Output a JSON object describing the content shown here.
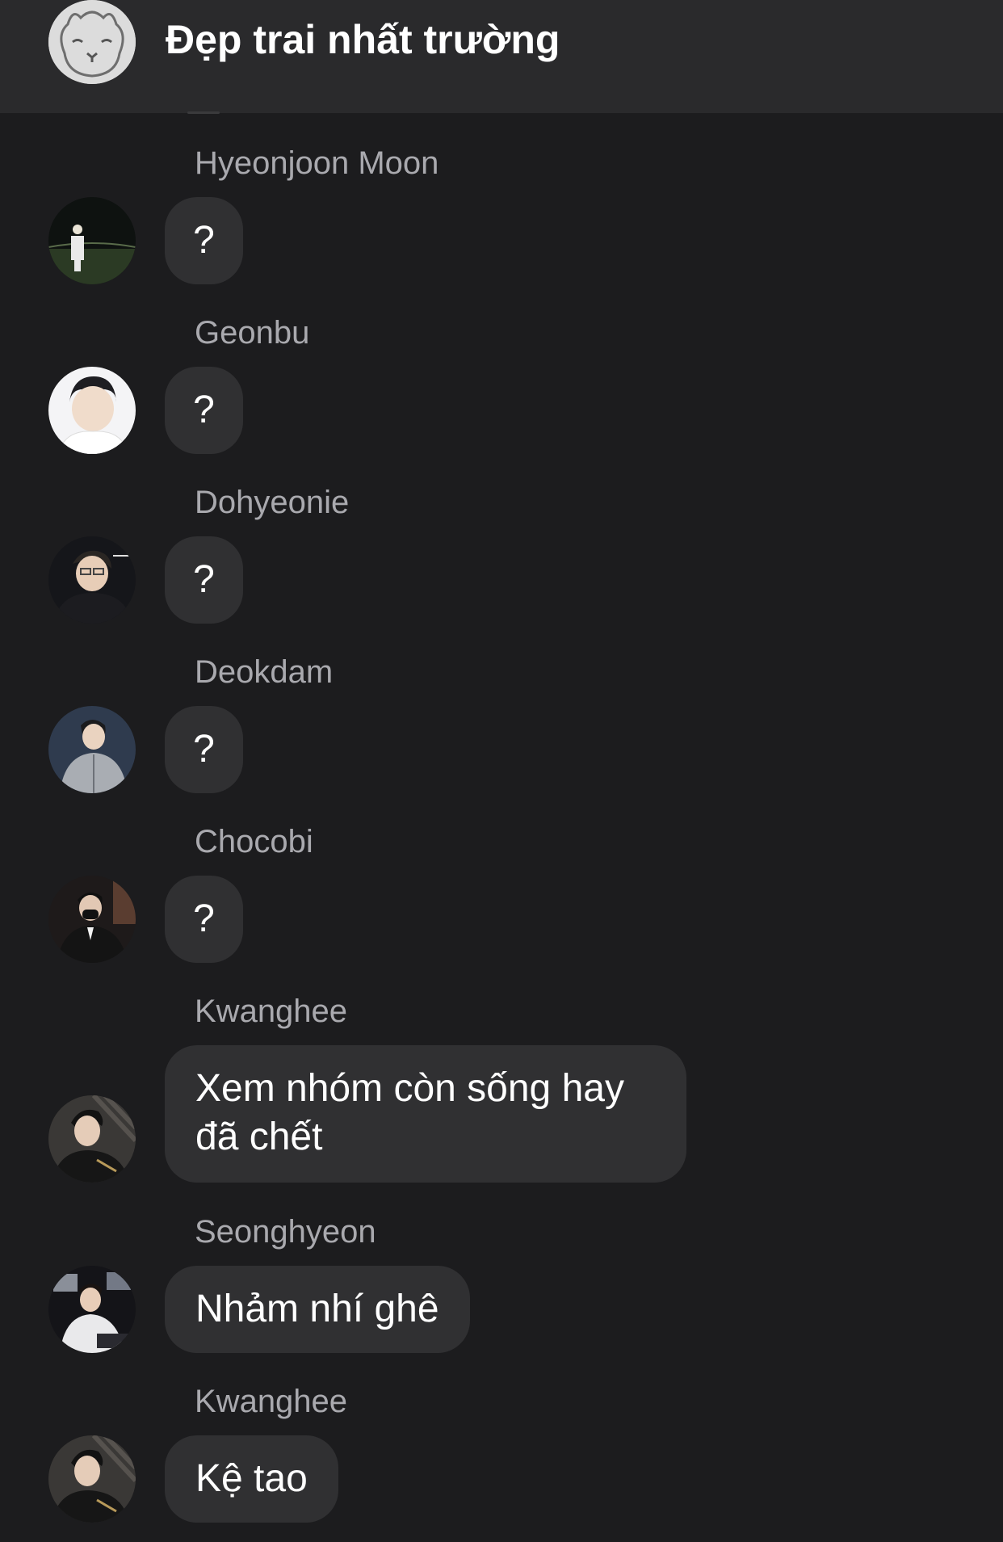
{
  "header": {
    "title": "Đẹp trai nhất trường",
    "avatar_icon": "alpaca-icon"
  },
  "messages": [
    {
      "sender": "Hyeonjoon Moon",
      "text": "?"
    },
    {
      "sender": "Geonbu",
      "text": "?"
    },
    {
      "sender": "Dohyeonie",
      "text": "?"
    },
    {
      "sender": "Deokdam",
      "text": "?"
    },
    {
      "sender": "Chocobi",
      "text": "?"
    },
    {
      "sender": "Kwanghee",
      "text": "Xem nhóm còn sống hay đã chết"
    },
    {
      "sender": "Seonghyeon",
      "text": "Nhảm nhí ghê"
    },
    {
      "sender": "Kwanghee",
      "text": "Kệ tao"
    }
  ],
  "colors": {
    "background": "#1c1c1e",
    "header": "#2a2a2c",
    "bubble": "#303032",
    "sender_text": "#a9a9ae"
  }
}
